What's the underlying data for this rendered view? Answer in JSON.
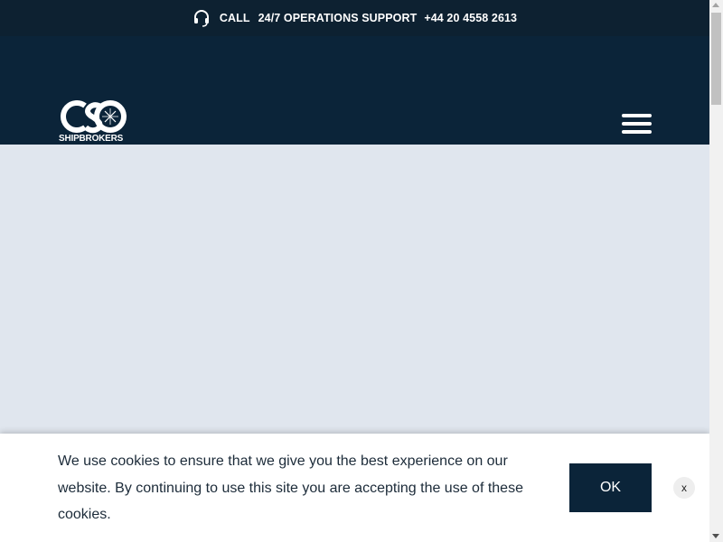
{
  "topbar": {
    "icon": "headset-icon",
    "call_label": "CALL",
    "support_label": "24/7 OPERATIONS SUPPORT",
    "phone": "+44 20 4558 2613"
  },
  "header": {
    "logo_mark": "CSO",
    "logo_word": "SHIPBROKERS",
    "menu_icon": "hamburger-menu-icon"
  },
  "cookie": {
    "message": "We use cookies to ensure that we give you the best experience on our website. By continuing to use this site you are accepting the use of these cookies.",
    "ok_label": "OK",
    "close_label": "x"
  },
  "colors": {
    "topbar_bg": "#0d2131",
    "header_bg": "#0b2439",
    "hero_bg": "#e0e6ee",
    "button_bg": "#0b2439"
  }
}
